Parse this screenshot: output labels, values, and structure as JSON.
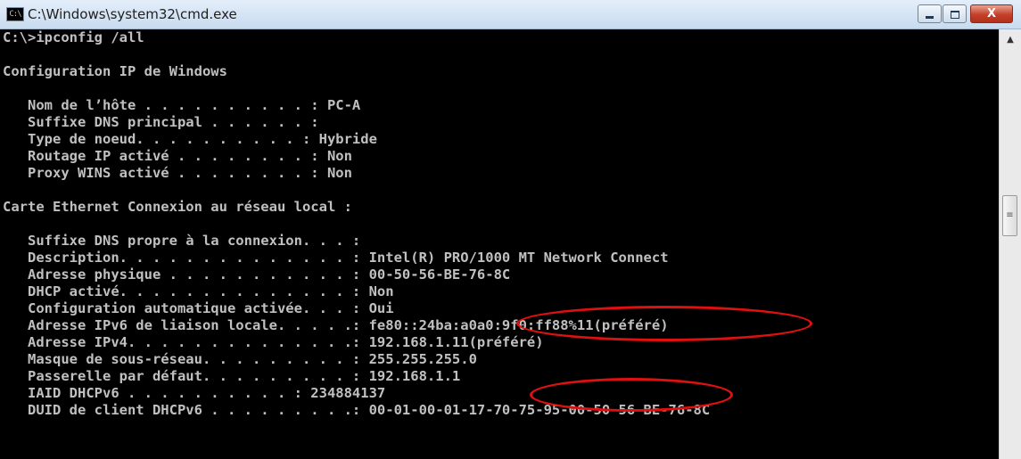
{
  "window": {
    "title": "C:\\Windows\\system32\\cmd.exe",
    "icon_label": "C:\\",
    "minimize_label": "minimize",
    "maximize_label": "maximize",
    "close_label": "X"
  },
  "console": {
    "lines": [
      "C:\\>ipconfig /all",
      "",
      "Configuration IP de Windows",
      "",
      "   Nom de l’hôte . . . . . . . . . . : PC-A",
      "   Suffixe DNS principal . . . . . . :",
      "   Type de noeud. . . . . . . . . . : Hybride",
      "   Routage IP activé . . . . . . . . : Non",
      "   Proxy WINS activé . . . . . . . . : Non",
      "",
      "Carte Ethernet Connexion au réseau local :",
      "",
      "   Suffixe DNS propre à la connexion. . . :",
      "   Description. . . . . . . . . . . . . . : Intel(R) PRO/1000 MT Network Connect",
      "   Adresse physique . . . . . . . . . . . : 00-50-56-BE-76-8C",
      "   DHCP activé. . . . . . . . . . . . . . : Non",
      "   Configuration automatique activée. . . : Oui",
      "   Adresse IPv6 de liaison locale. . . . .: fe80::24ba:a0a0:9f0:ff88%11(préféré)",
      "   Adresse IPv4. . . . . . . . . . . . . .: 192.168.1.11(préféré)",
      "   Masque de sous-réseau. . . . . . . . . : 255.255.255.0",
      "   Passerelle par défaut. . . . . . . . . : 192.168.1.1",
      "   IAID DHCPv6 . . . . . . . . . . : 234884137",
      "   DUID de client DHCPv6 . . . . . . . . .: 00-01-00-01-17-70-75-95-00-50-56-BE-76-8C"
    ]
  },
  "annotation_color": "#e01010"
}
